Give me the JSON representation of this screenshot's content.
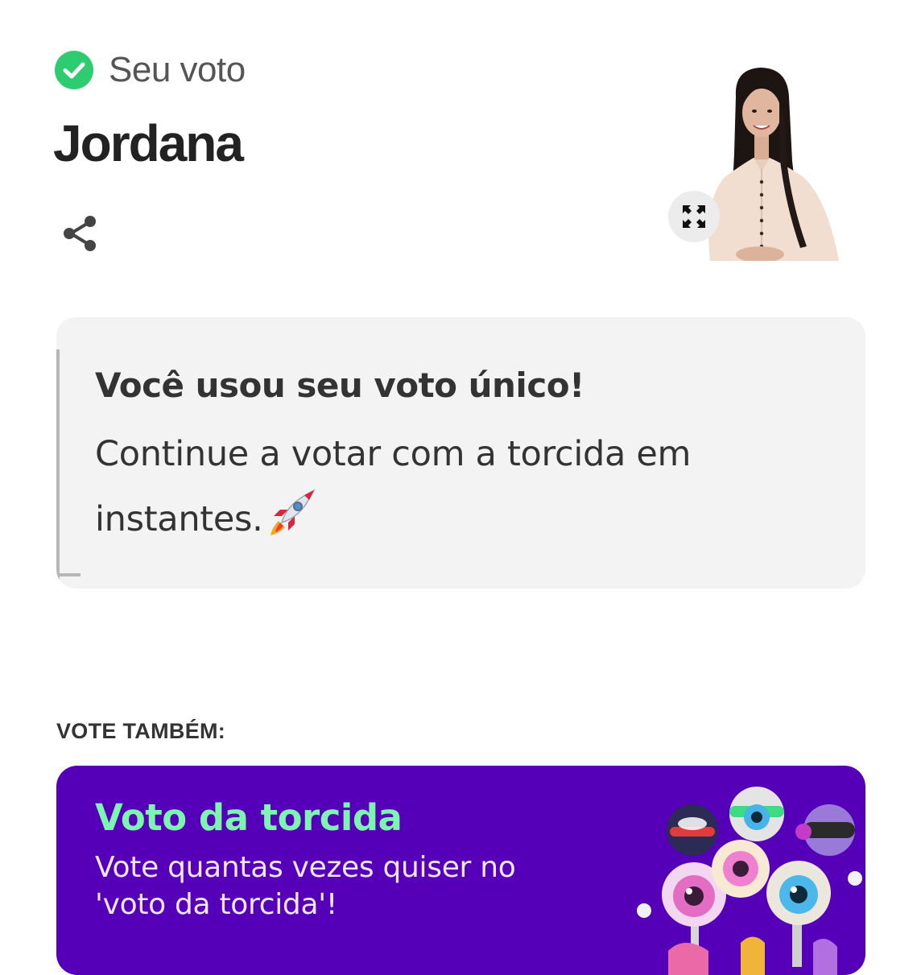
{
  "vote": {
    "status_label": "Seu voto",
    "candidate_name": "Jordana"
  },
  "info_card": {
    "title": "Você usou seu voto único!",
    "text": "Continue a votar com a torcida em instantes."
  },
  "vote_also": {
    "label": "VOTE TAMBÉM:"
  },
  "promo": {
    "title": "Voto da torcida",
    "text": "Vote quantas vezes quiser no 'voto da torcida'!"
  },
  "colors": {
    "check_green": "#2ecc71",
    "promo_background": "#5500b8",
    "promo_title": "#7df5b0",
    "card_background": "#f3f3f3"
  },
  "icons": {
    "status": "check-circle-icon",
    "share": "share-icon",
    "expand": "expand-icon",
    "rocket": "rocket-icon"
  }
}
